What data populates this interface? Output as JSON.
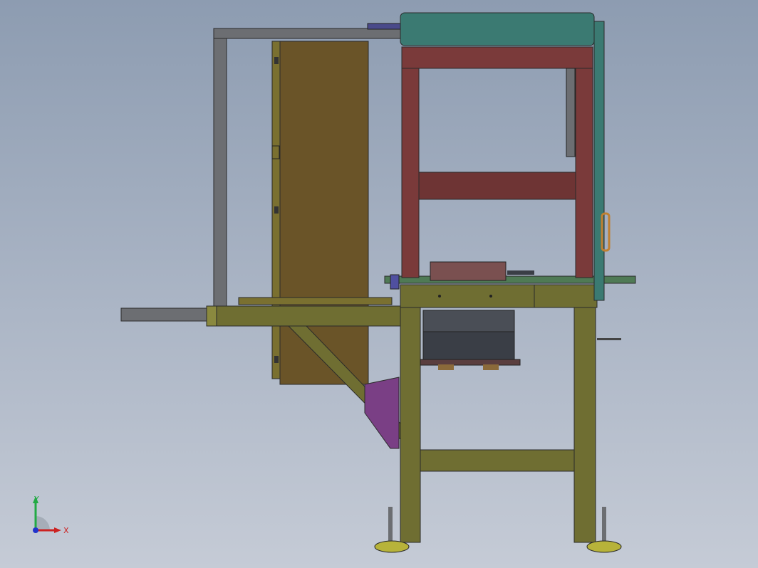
{
  "viewport": {
    "background_top": "#8d9cb1",
    "background_bottom": "#c5cbd6"
  },
  "model": {
    "colors": {
      "olive_frame": "#6f6e32",
      "olive_light": "#8a893f",
      "red_frame": "#7a3a3a",
      "teal_top": "#3b7a72",
      "brown_panel": "#6a5428",
      "gray_frame": "#6c6e72",
      "dark_box": "#44484f",
      "purple_part": "#7a3f85",
      "green_plate": "#4f7a55",
      "yellow_feet": "#b7b33a"
    }
  },
  "triad": {
    "x_label": "X",
    "y_label": "Y",
    "x_color": "#cc2222",
    "y_color": "#22aa44",
    "z_color": "#2233cc"
  }
}
